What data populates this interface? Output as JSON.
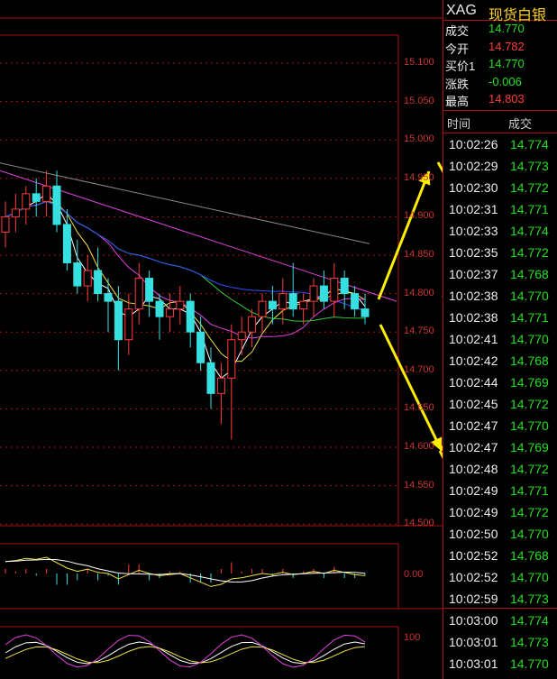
{
  "instrument": {
    "symbol": "XAG",
    "name": "现货白银"
  },
  "quote": [
    {
      "label": "成交",
      "value": "14.770",
      "color": "#21e021"
    },
    {
      "label": "今开",
      "value": "14.782",
      "color": "#ff3b3b"
    },
    {
      "label": "买价1",
      "value": "14.770",
      "color": "#21e021"
    },
    {
      "label": "涨跌",
      "value": "-0.006",
      "color": "#21e021"
    },
    {
      "label": "最高",
      "value": "14.803",
      "color": "#ff3b3b"
    }
  ],
  "ticks_header": {
    "time": "时间",
    "price": "成交"
  },
  "ticks": [
    {
      "time": "10:02:26",
      "price": "14.774"
    },
    {
      "time": "10:02:29",
      "price": "14.773"
    },
    {
      "time": "10:02:30",
      "price": "14.772"
    },
    {
      "time": "10:02:31",
      "price": "14.771"
    },
    {
      "time": "10:02:33",
      "price": "14.774"
    },
    {
      "time": "10:02:35",
      "price": "14.772"
    },
    {
      "time": "10:02:37",
      "price": "14.768"
    },
    {
      "time": "10:02:38",
      "price": "14.770"
    },
    {
      "time": "10:02:38",
      "price": "14.771"
    },
    {
      "time": "10:02:41",
      "price": "14.770"
    },
    {
      "time": "10:02:42",
      "price": "14.768"
    },
    {
      "time": "10:02:44",
      "price": "14.769"
    },
    {
      "time": "10:02:45",
      "price": "14.772"
    },
    {
      "time": "10:02:47",
      "price": "14.770"
    },
    {
      "time": "10:02:47",
      "price": "14.769"
    },
    {
      "time": "10:02:48",
      "price": "14.772"
    },
    {
      "time": "10:02:49",
      "price": "14.771"
    },
    {
      "time": "10:02:49",
      "price": "14.772"
    },
    {
      "time": "10:02:50",
      "price": "14.770"
    },
    {
      "time": "10:02:52",
      "price": "14.768"
    },
    {
      "time": "10:02:52",
      "price": "14.770"
    },
    {
      "time": "10:02:59",
      "price": "14.773"
    },
    {
      "time": "10:03:00",
      "price": "14.774"
    },
    {
      "time": "10:03:01",
      "price": "14.773"
    },
    {
      "time": "10:03:01",
      "price": "14.770"
    }
  ],
  "price_axis": [
    "15.100",
    "15.050",
    "15.000",
    "14.950",
    "14.900",
    "14.850",
    "14.800",
    "14.750",
    "14.700",
    "14.650",
    "14.600",
    "14.550",
    "14.500"
  ],
  "macd_axis": {
    "zero": "0.00"
  },
  "kdj_axis": {
    "top": "100"
  },
  "colors": {
    "up": "#ff3b3b",
    "down": "#21e021",
    "grid": "#a11",
    "accent": "#ffd21f"
  },
  "candles": [
    {
      "o": 14.88,
      "h": 14.92,
      "l": 14.86,
      "c": 14.9
    },
    {
      "o": 14.9,
      "h": 14.93,
      "l": 14.88,
      "c": 14.91
    },
    {
      "o": 14.91,
      "h": 14.94,
      "l": 14.89,
      "c": 14.93
    },
    {
      "o": 14.93,
      "h": 14.95,
      "l": 14.9,
      "c": 14.92
    },
    {
      "o": 14.92,
      "h": 14.96,
      "l": 14.9,
      "c": 14.94
    },
    {
      "o": 14.94,
      "h": 14.96,
      "l": 14.88,
      "c": 14.89
    },
    {
      "o": 14.89,
      "h": 14.91,
      "l": 14.83,
      "c": 14.84
    },
    {
      "o": 14.84,
      "h": 14.87,
      "l": 14.8,
      "c": 14.81
    },
    {
      "o": 14.81,
      "h": 14.85,
      "l": 14.79,
      "c": 14.83
    },
    {
      "o": 14.83,
      "h": 14.86,
      "l": 14.79,
      "c": 14.8
    },
    {
      "o": 14.8,
      "h": 14.82,
      "l": 14.75,
      "c": 14.79
    },
    {
      "o": 14.79,
      "h": 14.81,
      "l": 14.7,
      "c": 14.74
    },
    {
      "o": 14.74,
      "h": 14.8,
      "l": 14.72,
      "c": 14.78
    },
    {
      "o": 14.78,
      "h": 14.84,
      "l": 14.76,
      "c": 14.82
    },
    {
      "o": 14.82,
      "h": 14.83,
      "l": 14.77,
      "c": 14.79
    },
    {
      "o": 14.79,
      "h": 14.8,
      "l": 14.74,
      "c": 14.77
    },
    {
      "o": 14.77,
      "h": 14.8,
      "l": 14.75,
      "c": 14.78
    },
    {
      "o": 14.78,
      "h": 14.81,
      "l": 14.76,
      "c": 14.79
    },
    {
      "o": 14.79,
      "h": 14.8,
      "l": 14.73,
      "c": 14.75
    },
    {
      "o": 14.75,
      "h": 14.77,
      "l": 14.7,
      "c": 14.71
    },
    {
      "o": 14.71,
      "h": 14.73,
      "l": 14.65,
      "c": 14.67
    },
    {
      "o": 14.67,
      "h": 14.71,
      "l": 14.63,
      "c": 14.69
    },
    {
      "o": 14.69,
      "h": 14.76,
      "l": 14.61,
      "c": 14.74
    },
    {
      "o": 14.74,
      "h": 14.77,
      "l": 14.72,
      "c": 14.75
    },
    {
      "o": 14.75,
      "h": 14.78,
      "l": 14.73,
      "c": 14.77
    },
    {
      "o": 14.77,
      "h": 14.8,
      "l": 14.75,
      "c": 14.79
    },
    {
      "o": 14.79,
      "h": 14.81,
      "l": 14.76,
      "c": 14.78
    },
    {
      "o": 14.78,
      "h": 14.82,
      "l": 14.76,
      "c": 14.8
    },
    {
      "o": 14.8,
      "h": 14.84,
      "l": 14.77,
      "c": 14.78
    },
    {
      "o": 14.78,
      "h": 14.8,
      "l": 14.76,
      "c": 14.79
    },
    {
      "o": 14.79,
      "h": 14.82,
      "l": 14.77,
      "c": 14.81
    },
    {
      "o": 14.81,
      "h": 14.83,
      "l": 14.78,
      "c": 14.79
    },
    {
      "o": 14.79,
      "h": 14.84,
      "l": 14.77,
      "c": 14.82
    },
    {
      "o": 14.82,
      "h": 14.83,
      "l": 14.78,
      "c": 14.8
    },
    {
      "o": 14.8,
      "h": 14.81,
      "l": 14.77,
      "c": 14.78
    },
    {
      "o": 14.78,
      "h": 14.8,
      "l": 14.76,
      "c": 14.77
    }
  ]
}
